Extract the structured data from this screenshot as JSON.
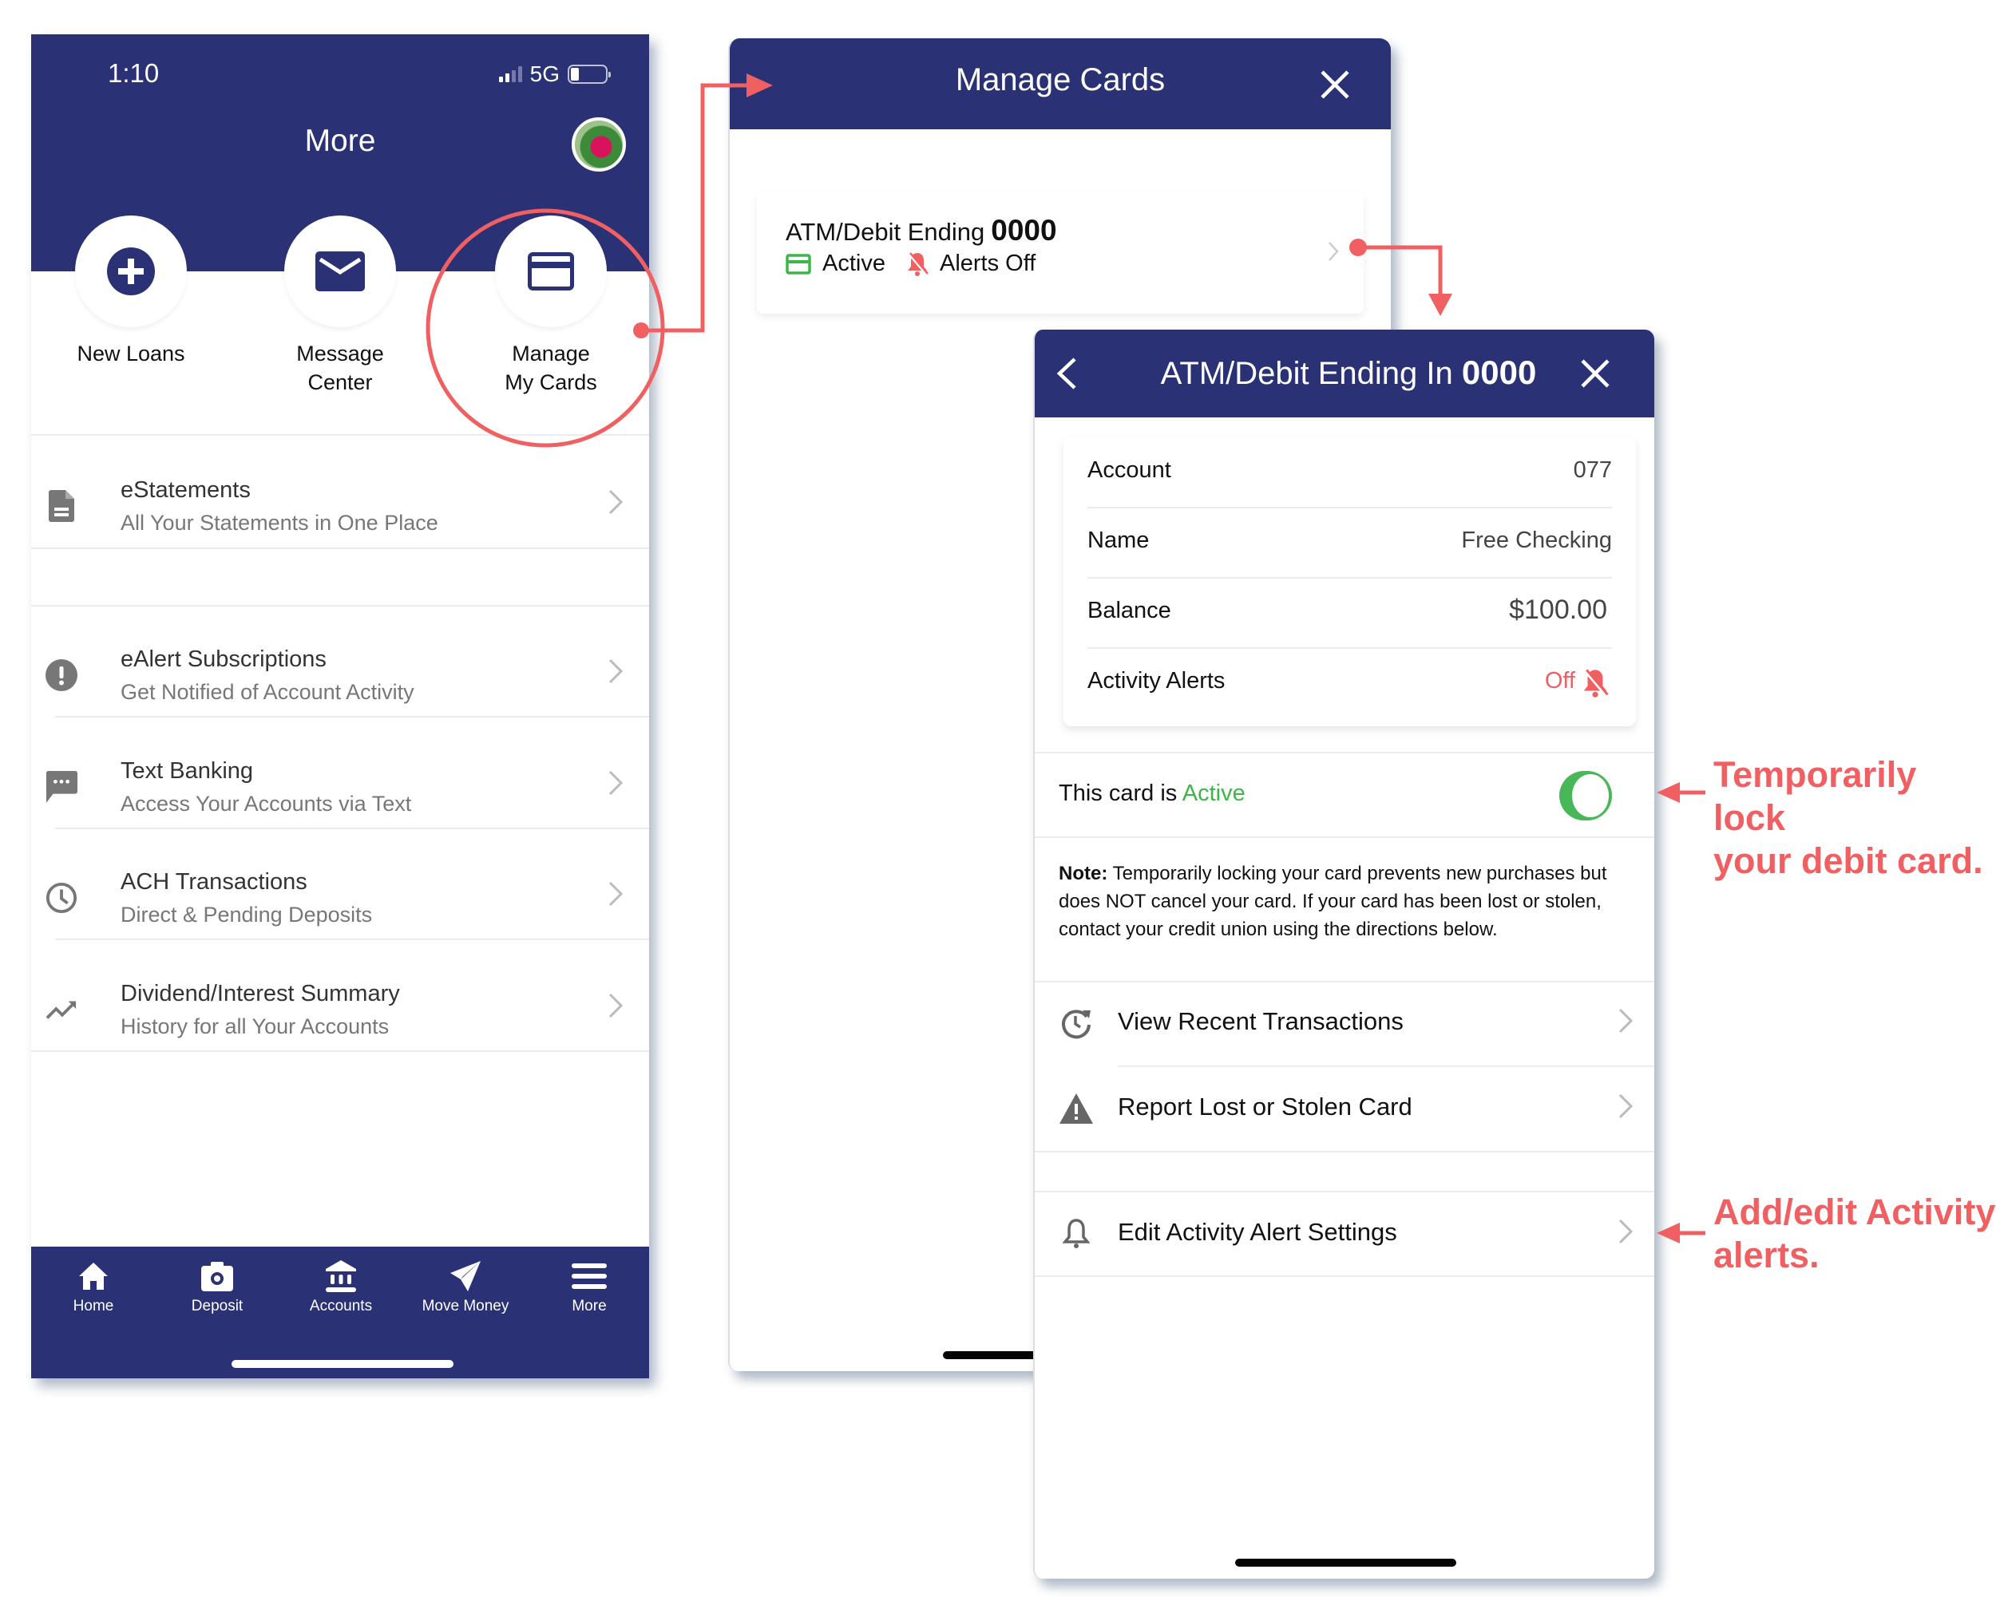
{
  "colors": {
    "brand_navy": "#2a3275",
    "annotation_red": "#f06062",
    "active_green": "#3db54a",
    "alert_off_red": "#f06062"
  },
  "screen_more": {
    "status_bar": {
      "time": "1:10",
      "network": "5G"
    },
    "title": "More",
    "avatar_icon": "profile-photo",
    "quick_actions": [
      {
        "label_line1": "New Loans",
        "label_line2": "",
        "icon": "plus-circle-icon"
      },
      {
        "label_line1": "Message",
        "label_line2": "Center",
        "icon": "envelope-icon"
      },
      {
        "label_line1": "Manage",
        "label_line2": "My Cards",
        "icon": "credit-card-icon"
      }
    ],
    "menu_items": [
      {
        "title": "eStatements",
        "subtitle": "All Your Statements in One Place",
        "icon": "document-icon"
      },
      {
        "title": "eAlert Subscriptions",
        "subtitle": "Get Notified of Account Activity",
        "icon": "alert-circle-icon"
      },
      {
        "title": "Text Banking",
        "subtitle": "Access Your Accounts via Text",
        "icon": "chat-bubble-icon"
      },
      {
        "title": "ACH Transactions",
        "subtitle": "Direct & Pending Deposits",
        "icon": "clock-icon"
      },
      {
        "title": "Dividend/Interest Summary",
        "subtitle": "History for all Your Accounts",
        "icon": "trending-up-icon"
      }
    ],
    "tab_bar": [
      {
        "label": "Home",
        "icon": "home-icon"
      },
      {
        "label": "Deposit",
        "icon": "camera-icon"
      },
      {
        "label": "Accounts",
        "icon": "bank-icon"
      },
      {
        "label": "Move Money",
        "icon": "send-icon"
      },
      {
        "label": "More",
        "icon": "menu-icon"
      }
    ]
  },
  "screen_manage_cards": {
    "title": "Manage Cards",
    "card": {
      "label": "ATM/Debit Ending",
      "last4": "0000",
      "status": "Active",
      "alerts": "Alerts Off"
    }
  },
  "screen_card_detail": {
    "title_prefix": "ATM/Debit Ending In",
    "last4": "0000",
    "info": [
      {
        "key": "Account",
        "value": "077"
      },
      {
        "key": "Name",
        "value": "Free Checking"
      },
      {
        "key": "Balance",
        "value": "$100.00"
      },
      {
        "key": "Activity Alerts",
        "value": "Off"
      }
    ],
    "card_status_prefix": "This card is",
    "card_status": "Active",
    "card_active_toggle": true,
    "note_label": "Note:",
    "note_text": "Temporarily locking your card prevents new purchases but does NOT cancel your card. If your card has been lost or stolen, contact your credit union using the directions below.",
    "actions": [
      {
        "label": "View Recent Transactions",
        "icon": "history-icon"
      },
      {
        "label": "Report Lost or Stolen Card",
        "icon": "warning-triangle-icon"
      },
      {
        "label": "Edit Activity Alert Settings",
        "icon": "bell-icon"
      }
    ]
  },
  "annotations": {
    "toggle_note_line1": "Temporarily lock",
    "toggle_note_line2": "your debit card.",
    "alerts_note_line1": "Add/edit Activity",
    "alerts_note_line2": "alerts."
  }
}
